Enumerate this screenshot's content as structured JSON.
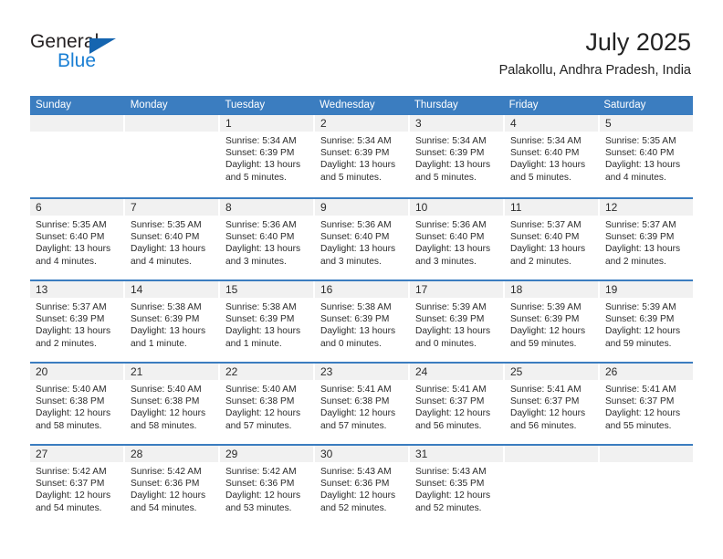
{
  "brand": {
    "name_dark": "General",
    "name_blue": "Blue",
    "accent_color": "#1a7fd4",
    "logo_triangle_color": "#1565b0"
  },
  "header": {
    "title": "July 2025",
    "subtitle": "Palakollu, Andhra Pradesh, India",
    "header_bg_color": "#3b7dc0"
  },
  "weekdays": [
    "Sunday",
    "Monday",
    "Tuesday",
    "Wednesday",
    "Thursday",
    "Friday",
    "Saturday"
  ],
  "weeks": [
    [
      {
        "day": "",
        "sunrise": "",
        "sunset": "",
        "daylight_line1": "",
        "daylight_line2": "",
        "empty": true
      },
      {
        "day": "",
        "sunrise": "",
        "sunset": "",
        "daylight_line1": "",
        "daylight_line2": "",
        "empty": true
      },
      {
        "day": "1",
        "sunrise": "Sunrise: 5:34 AM",
        "sunset": "Sunset: 6:39 PM",
        "daylight_line1": "Daylight: 13 hours",
        "daylight_line2": "and 5 minutes."
      },
      {
        "day": "2",
        "sunrise": "Sunrise: 5:34 AM",
        "sunset": "Sunset: 6:39 PM",
        "daylight_line1": "Daylight: 13 hours",
        "daylight_line2": "and 5 minutes."
      },
      {
        "day": "3",
        "sunrise": "Sunrise: 5:34 AM",
        "sunset": "Sunset: 6:39 PM",
        "daylight_line1": "Daylight: 13 hours",
        "daylight_line2": "and 5 minutes."
      },
      {
        "day": "4",
        "sunrise": "Sunrise: 5:34 AM",
        "sunset": "Sunset: 6:40 PM",
        "daylight_line1": "Daylight: 13 hours",
        "daylight_line2": "and 5 minutes."
      },
      {
        "day": "5",
        "sunrise": "Sunrise: 5:35 AM",
        "sunset": "Sunset: 6:40 PM",
        "daylight_line1": "Daylight: 13 hours",
        "daylight_line2": "and 4 minutes."
      }
    ],
    [
      {
        "day": "6",
        "sunrise": "Sunrise: 5:35 AM",
        "sunset": "Sunset: 6:40 PM",
        "daylight_line1": "Daylight: 13 hours",
        "daylight_line2": "and 4 minutes."
      },
      {
        "day": "7",
        "sunrise": "Sunrise: 5:35 AM",
        "sunset": "Sunset: 6:40 PM",
        "daylight_line1": "Daylight: 13 hours",
        "daylight_line2": "and 4 minutes."
      },
      {
        "day": "8",
        "sunrise": "Sunrise: 5:36 AM",
        "sunset": "Sunset: 6:40 PM",
        "daylight_line1": "Daylight: 13 hours",
        "daylight_line2": "and 3 minutes."
      },
      {
        "day": "9",
        "sunrise": "Sunrise: 5:36 AM",
        "sunset": "Sunset: 6:40 PM",
        "daylight_line1": "Daylight: 13 hours",
        "daylight_line2": "and 3 minutes."
      },
      {
        "day": "10",
        "sunrise": "Sunrise: 5:36 AM",
        "sunset": "Sunset: 6:40 PM",
        "daylight_line1": "Daylight: 13 hours",
        "daylight_line2": "and 3 minutes."
      },
      {
        "day": "11",
        "sunrise": "Sunrise: 5:37 AM",
        "sunset": "Sunset: 6:40 PM",
        "daylight_line1": "Daylight: 13 hours",
        "daylight_line2": "and 2 minutes."
      },
      {
        "day": "12",
        "sunrise": "Sunrise: 5:37 AM",
        "sunset": "Sunset: 6:39 PM",
        "daylight_line1": "Daylight: 13 hours",
        "daylight_line2": "and 2 minutes."
      }
    ],
    [
      {
        "day": "13",
        "sunrise": "Sunrise: 5:37 AM",
        "sunset": "Sunset: 6:39 PM",
        "daylight_line1": "Daylight: 13 hours",
        "daylight_line2": "and 2 minutes."
      },
      {
        "day": "14",
        "sunrise": "Sunrise: 5:38 AM",
        "sunset": "Sunset: 6:39 PM",
        "daylight_line1": "Daylight: 13 hours",
        "daylight_line2": "and 1 minute."
      },
      {
        "day": "15",
        "sunrise": "Sunrise: 5:38 AM",
        "sunset": "Sunset: 6:39 PM",
        "daylight_line1": "Daylight: 13 hours",
        "daylight_line2": "and 1 minute."
      },
      {
        "day": "16",
        "sunrise": "Sunrise: 5:38 AM",
        "sunset": "Sunset: 6:39 PM",
        "daylight_line1": "Daylight: 13 hours",
        "daylight_line2": "and 0 minutes."
      },
      {
        "day": "17",
        "sunrise": "Sunrise: 5:39 AM",
        "sunset": "Sunset: 6:39 PM",
        "daylight_line1": "Daylight: 13 hours",
        "daylight_line2": "and 0 minutes."
      },
      {
        "day": "18",
        "sunrise": "Sunrise: 5:39 AM",
        "sunset": "Sunset: 6:39 PM",
        "daylight_line1": "Daylight: 12 hours",
        "daylight_line2": "and 59 minutes."
      },
      {
        "day": "19",
        "sunrise": "Sunrise: 5:39 AM",
        "sunset": "Sunset: 6:39 PM",
        "daylight_line1": "Daylight: 12 hours",
        "daylight_line2": "and 59 minutes."
      }
    ],
    [
      {
        "day": "20",
        "sunrise": "Sunrise: 5:40 AM",
        "sunset": "Sunset: 6:38 PM",
        "daylight_line1": "Daylight: 12 hours",
        "daylight_line2": "and 58 minutes."
      },
      {
        "day": "21",
        "sunrise": "Sunrise: 5:40 AM",
        "sunset": "Sunset: 6:38 PM",
        "daylight_line1": "Daylight: 12 hours",
        "daylight_line2": "and 58 minutes."
      },
      {
        "day": "22",
        "sunrise": "Sunrise: 5:40 AM",
        "sunset": "Sunset: 6:38 PM",
        "daylight_line1": "Daylight: 12 hours",
        "daylight_line2": "and 57 minutes."
      },
      {
        "day": "23",
        "sunrise": "Sunrise: 5:41 AM",
        "sunset": "Sunset: 6:38 PM",
        "daylight_line1": "Daylight: 12 hours",
        "daylight_line2": "and 57 minutes."
      },
      {
        "day": "24",
        "sunrise": "Sunrise: 5:41 AM",
        "sunset": "Sunset: 6:37 PM",
        "daylight_line1": "Daylight: 12 hours",
        "daylight_line2": "and 56 minutes."
      },
      {
        "day": "25",
        "sunrise": "Sunrise: 5:41 AM",
        "sunset": "Sunset: 6:37 PM",
        "daylight_line1": "Daylight: 12 hours",
        "daylight_line2": "and 56 minutes."
      },
      {
        "day": "26",
        "sunrise": "Sunrise: 5:41 AM",
        "sunset": "Sunset: 6:37 PM",
        "daylight_line1": "Daylight: 12 hours",
        "daylight_line2": "and 55 minutes."
      }
    ],
    [
      {
        "day": "27",
        "sunrise": "Sunrise: 5:42 AM",
        "sunset": "Sunset: 6:37 PM",
        "daylight_line1": "Daylight: 12 hours",
        "daylight_line2": "and 54 minutes."
      },
      {
        "day": "28",
        "sunrise": "Sunrise: 5:42 AM",
        "sunset": "Sunset: 6:36 PM",
        "daylight_line1": "Daylight: 12 hours",
        "daylight_line2": "and 54 minutes."
      },
      {
        "day": "29",
        "sunrise": "Sunrise: 5:42 AM",
        "sunset": "Sunset: 6:36 PM",
        "daylight_line1": "Daylight: 12 hours",
        "daylight_line2": "and 53 minutes."
      },
      {
        "day": "30",
        "sunrise": "Sunrise: 5:43 AM",
        "sunset": "Sunset: 6:36 PM",
        "daylight_line1": "Daylight: 12 hours",
        "daylight_line2": "and 52 minutes."
      },
      {
        "day": "31",
        "sunrise": "Sunrise: 5:43 AM",
        "sunset": "Sunset: 6:35 PM",
        "daylight_line1": "Daylight: 12 hours",
        "daylight_line2": "and 52 minutes."
      },
      {
        "day": "",
        "sunrise": "",
        "sunset": "",
        "daylight_line1": "",
        "daylight_line2": "",
        "empty": true
      },
      {
        "day": "",
        "sunrise": "",
        "sunset": "",
        "daylight_line1": "",
        "daylight_line2": "",
        "empty": true
      }
    ]
  ]
}
